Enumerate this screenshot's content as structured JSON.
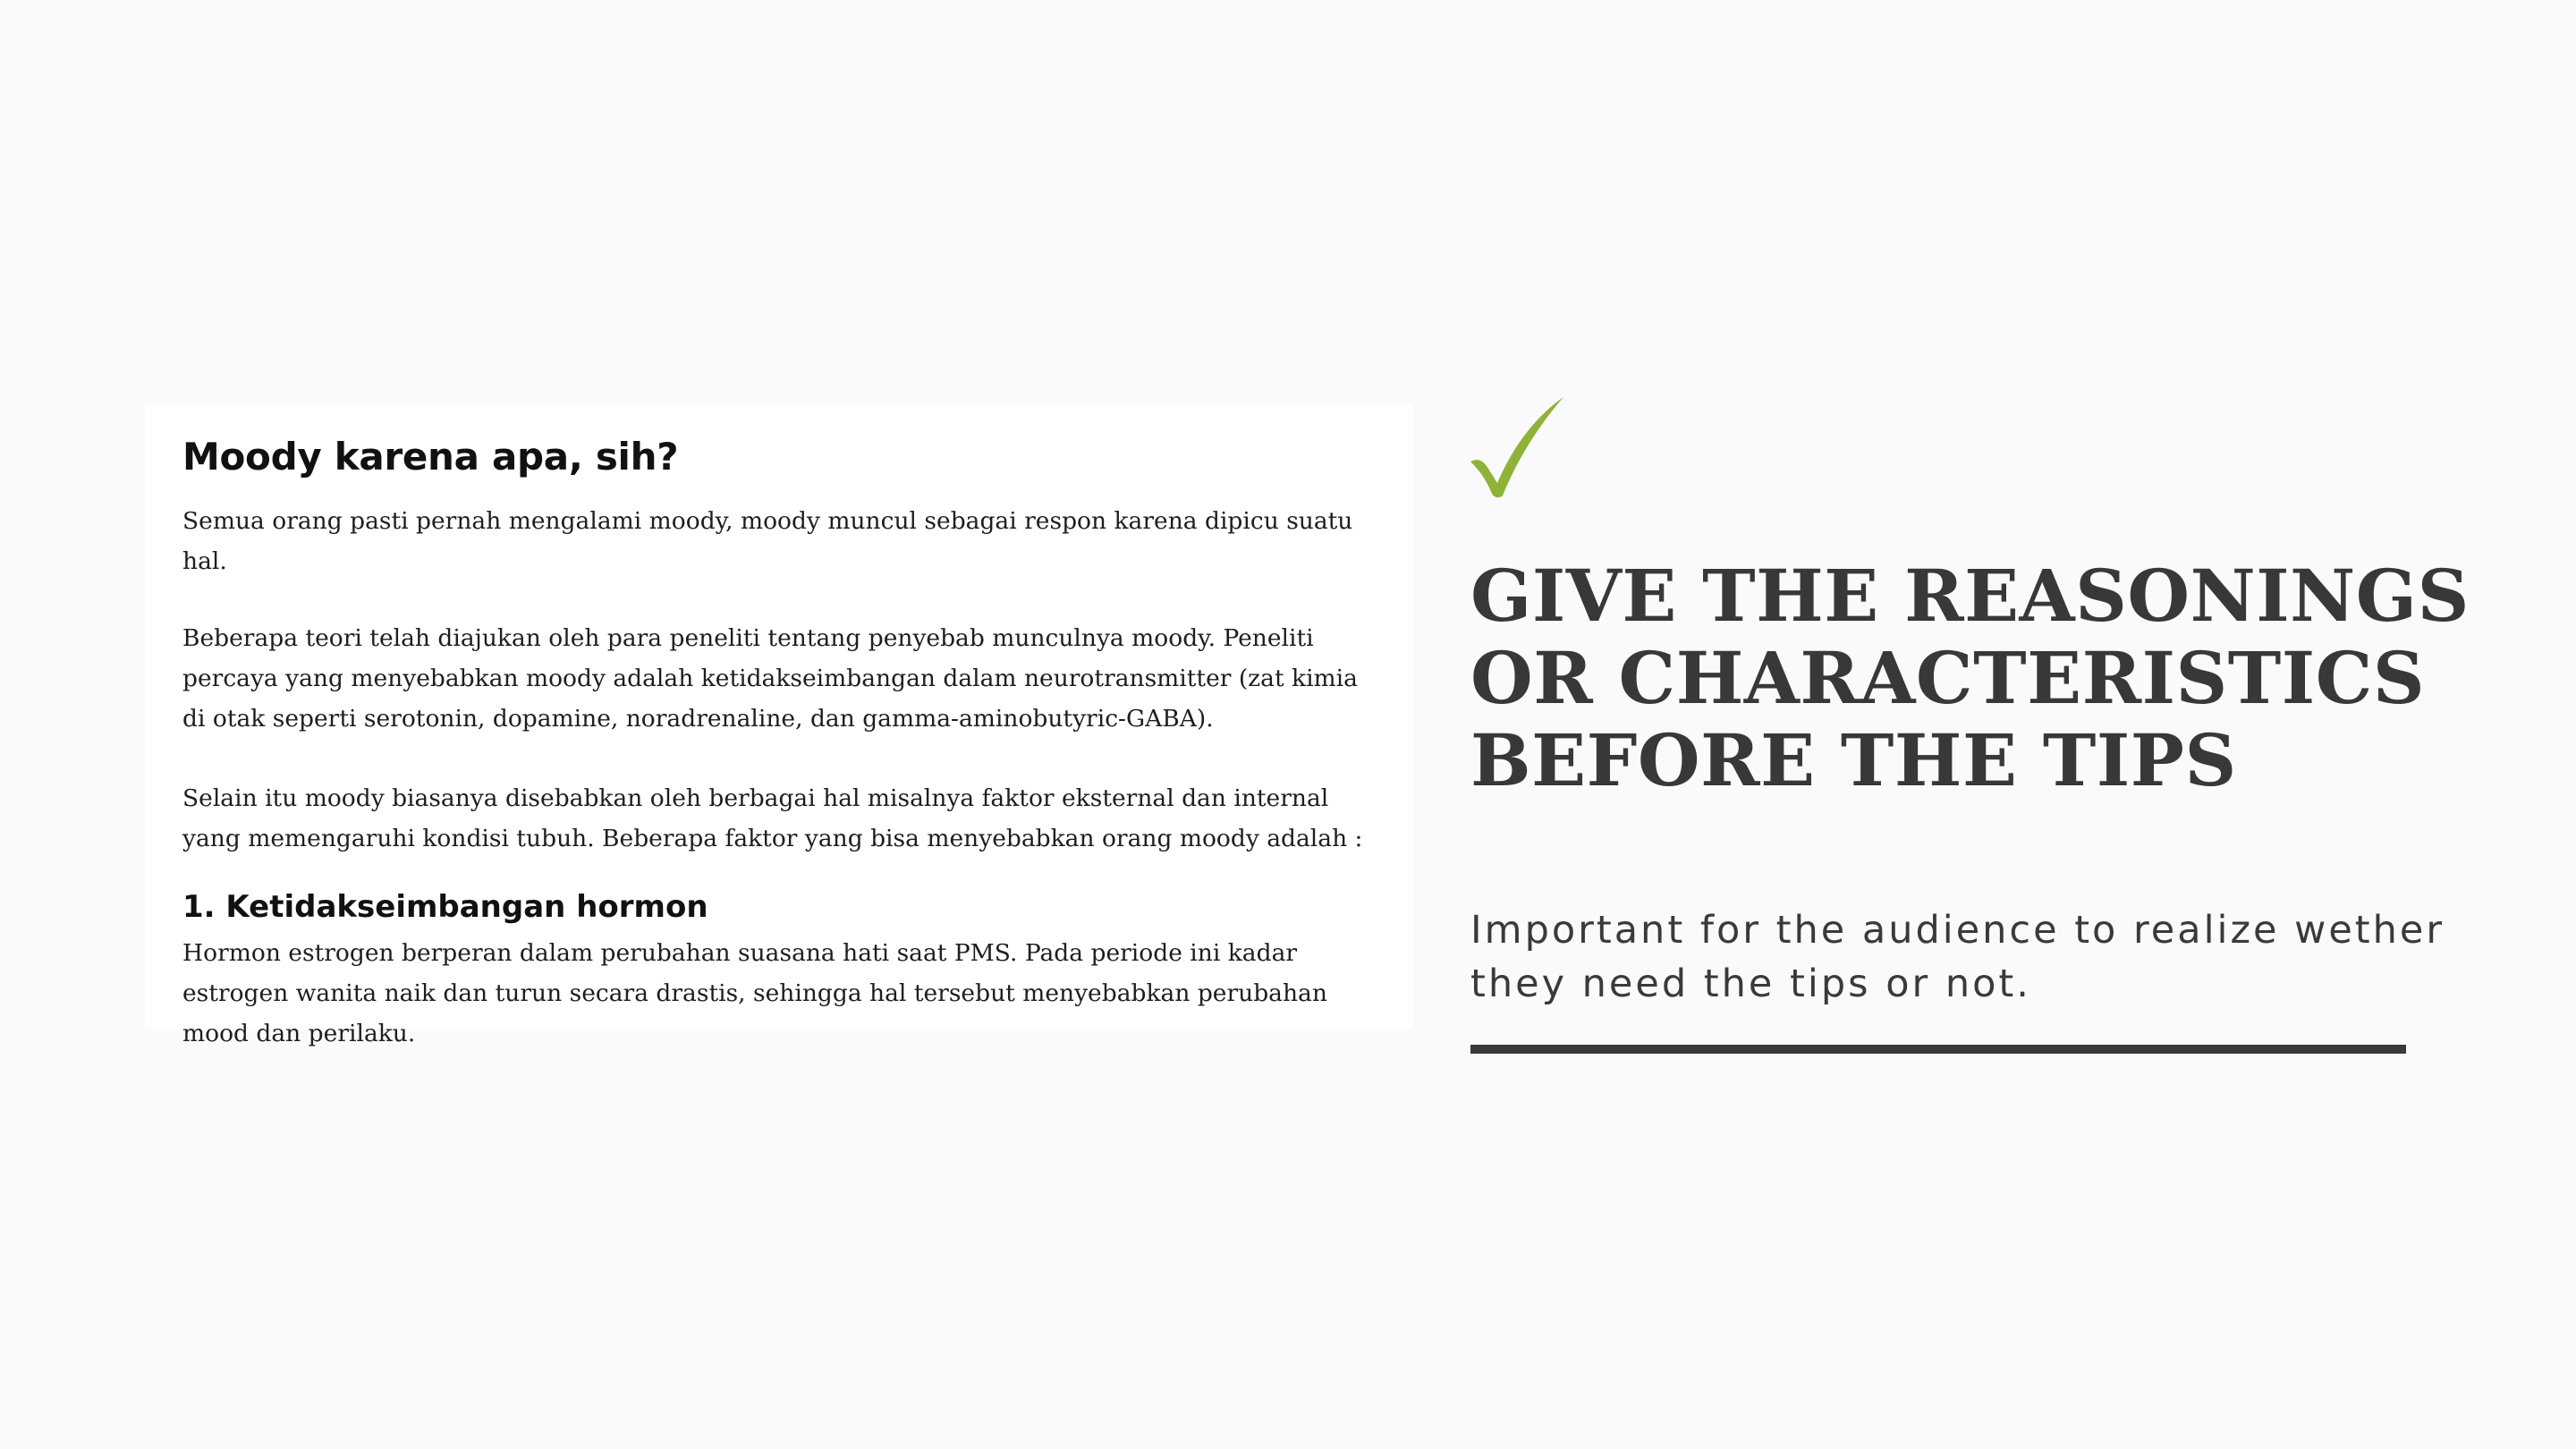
{
  "article": {
    "title": "Moody karena apa, sih?",
    "paragraph1": "Semua orang pasti pernah mengalami moody, moody muncul sebagai respon karena dipicu suatu hal.",
    "paragraph2": "Beberapa teori telah diajukan oleh para peneliti tentang penyebab munculnya moody. Peneliti percaya yang menyebabkan moody adalah ketidakseimbangan dalam neurotransmitter (zat kimia di otak seperti serotonin, dopamine, noradrenaline, dan gamma-aminobutyric-GABA).",
    "paragraph3": "Selain itu moody biasanya disebabkan oleh berbagai hal misalnya faktor eksternal dan internal yang memengaruhi kondisi tubuh. Beberapa faktor yang bisa menyebabkan orang moody adalah :",
    "subheading": "1. Ketidakseimbangan hormon",
    "paragraph4": "Hormon estrogen berperan dalam perubahan suasana hati saat PMS. Pada periode ini kadar estrogen wanita naik dan turun secara drastis, sehingga hal tersebut menyebabkan perubahan mood dan perilaku."
  },
  "sidebar": {
    "icon": "checkmark-icon",
    "headline": "GIVE THE REASONINGS\nOR CHARACTERISTICS\nBEFORE THE TIPS",
    "subtext": "Important for the audience to realize wether they need the tips or not."
  },
  "colors": {
    "background": "#fafafa",
    "card": "#ffffff",
    "accent_green": "#8fb339",
    "headline": "#383838"
  }
}
